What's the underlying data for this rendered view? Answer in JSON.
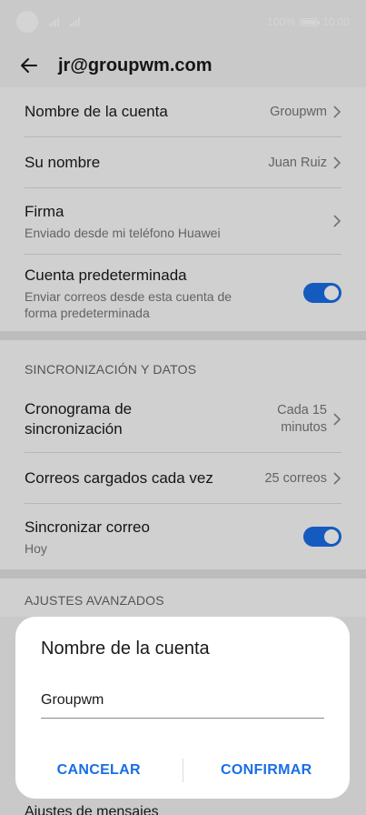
{
  "status_bar": {
    "battery": "100%",
    "time": "10:00"
  },
  "header": {
    "title": "jr@groupwm.com"
  },
  "account": {
    "rows": [
      {
        "title": "Nombre de la cuenta",
        "value": "Groupwm"
      },
      {
        "title": "Su nombre",
        "value": "Juan Ruiz"
      },
      {
        "title": "Firma",
        "subtitle": "Enviado desde mi teléfono Huawei"
      },
      {
        "title": "Cuenta predeterminada",
        "subtitle": "Enviar correos desde esta cuenta de forma predeterminada",
        "toggle_on": true
      }
    ]
  },
  "sync": {
    "section_title": "SINCRONIZACIÓN Y DATOS",
    "rows": [
      {
        "title": "Cronograma de sincronización",
        "value_line1": "Cada 15",
        "value_line2": "minutos"
      },
      {
        "title": "Correos cargados cada vez",
        "value": "25 correos"
      },
      {
        "title": "Sincronizar correo",
        "subtitle": "Hoy",
        "toggle_on": true
      }
    ]
  },
  "advanced": {
    "section_title": "AJUSTES AVANZADOS",
    "peek_item": "Ajustes de mensajes"
  },
  "dialog": {
    "title": "Nombre de la cuenta",
    "input_value": "Groupwm",
    "cancel_label": "CANCELAR",
    "confirm_label": "CONFIRMAR"
  },
  "colors": {
    "accent": "#1a6ee6",
    "background": "#f2f2f2",
    "dialog": "#ffffff"
  }
}
